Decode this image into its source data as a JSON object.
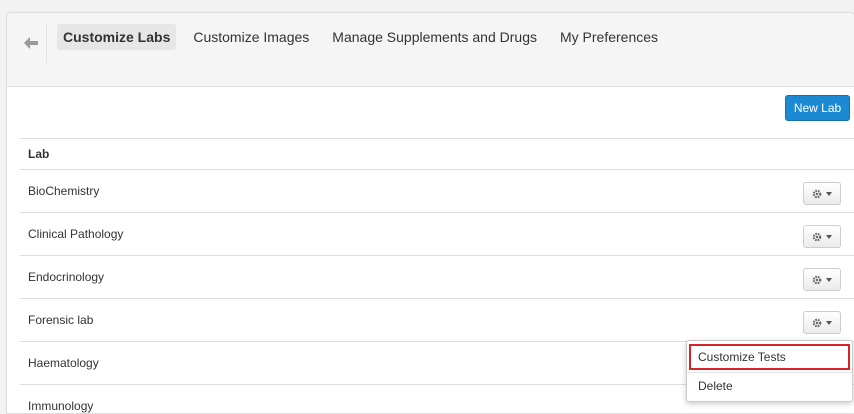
{
  "nav": {
    "tabs": [
      {
        "label": "Customize Labs",
        "active": true
      },
      {
        "label": "Customize Images",
        "active": false
      },
      {
        "label": "Manage Supplements and Drugs",
        "active": false
      },
      {
        "label": "My Preferences",
        "active": false
      }
    ]
  },
  "actions": {
    "new_lab_label": "New Lab"
  },
  "table": {
    "header": "Lab",
    "rows": [
      "BioChemistry",
      "Clinical Pathology",
      "Endocrinology",
      "Forensic lab",
      "Haematology",
      "Immunology"
    ]
  },
  "dropdown": {
    "items": [
      "Customize Tests",
      "Delete"
    ]
  },
  "colors": {
    "accent": "#1b8ad3",
    "highlight_border": "#d9232a"
  }
}
